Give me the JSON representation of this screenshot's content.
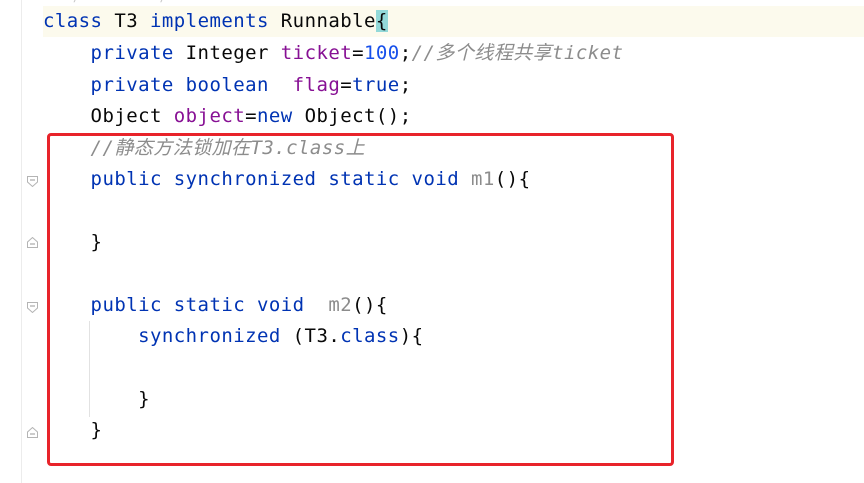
{
  "editor": {
    "top_cut_text": "    /           /",
    "lines": [
      {
        "segments": [
          {
            "text": "class ",
            "cls": "kw"
          },
          {
            "text": "T3 ",
            "cls": ""
          },
          {
            "text": "implements ",
            "cls": "kw"
          },
          {
            "text": "Runnable",
            "cls": ""
          },
          {
            "text": "{",
            "cls": "brace-hl"
          }
        ]
      },
      {
        "segments": [
          {
            "text": "    private ",
            "cls": "kw"
          },
          {
            "text": "Integer ",
            "cls": ""
          },
          {
            "text": "ticket",
            "cls": "field"
          },
          {
            "text": "=",
            "cls": ""
          },
          {
            "text": "100",
            "cls": "num"
          },
          {
            "text": ";",
            "cls": ""
          },
          {
            "text": "//多个线程共享ticket",
            "cls": "comment"
          }
        ]
      },
      {
        "segments": [
          {
            "text": "    private boolean  ",
            "cls": "kw"
          },
          {
            "text": "flag",
            "cls": "field"
          },
          {
            "text": "=",
            "cls": ""
          },
          {
            "text": "true",
            "cls": "kw"
          },
          {
            "text": ";",
            "cls": ""
          }
        ]
      },
      {
        "segments": [
          {
            "text": "    Object ",
            "cls": ""
          },
          {
            "text": "object",
            "cls": "field"
          },
          {
            "text": "=",
            "cls": ""
          },
          {
            "text": "new ",
            "cls": "kw"
          },
          {
            "text": "Object();",
            "cls": ""
          }
        ]
      },
      {
        "segments": [
          {
            "text": "    //静态方法锁加在T3.class上",
            "cls": "comment"
          }
        ]
      },
      {
        "segments": [
          {
            "text": "    public synchronized static void ",
            "cls": "kw"
          },
          {
            "text": "m1",
            "cls": "method-gray"
          },
          {
            "text": "(){",
            "cls": ""
          }
        ]
      },
      {
        "segments": []
      },
      {
        "segments": [
          {
            "text": "    }",
            "cls": ""
          }
        ]
      },
      {
        "segments": []
      },
      {
        "segments": [
          {
            "text": "    public static void  ",
            "cls": "kw"
          },
          {
            "text": "m2",
            "cls": "method-gray"
          },
          {
            "text": "(){",
            "cls": ""
          }
        ]
      },
      {
        "segments": [
          {
            "text": "        synchronized ",
            "cls": "kw"
          },
          {
            "text": "(T3.",
            "cls": ""
          },
          {
            "text": "class",
            "cls": "kw"
          },
          {
            "text": "){",
            "cls": ""
          }
        ]
      },
      {
        "segments": []
      },
      {
        "segments": [
          {
            "text": "        }",
            "cls": ""
          }
        ]
      },
      {
        "segments": [
          {
            "text": "    }",
            "cls": ""
          }
        ]
      }
    ]
  },
  "colors": {
    "keyword": "#0033b3",
    "field": "#871094",
    "number": "#1750eb",
    "comment": "#8c8c8c",
    "annotation_box": "#e8232a",
    "brace_match": "#93d9d9"
  },
  "icons": [
    "fold-start-icon",
    "fold-end-icon"
  ]
}
